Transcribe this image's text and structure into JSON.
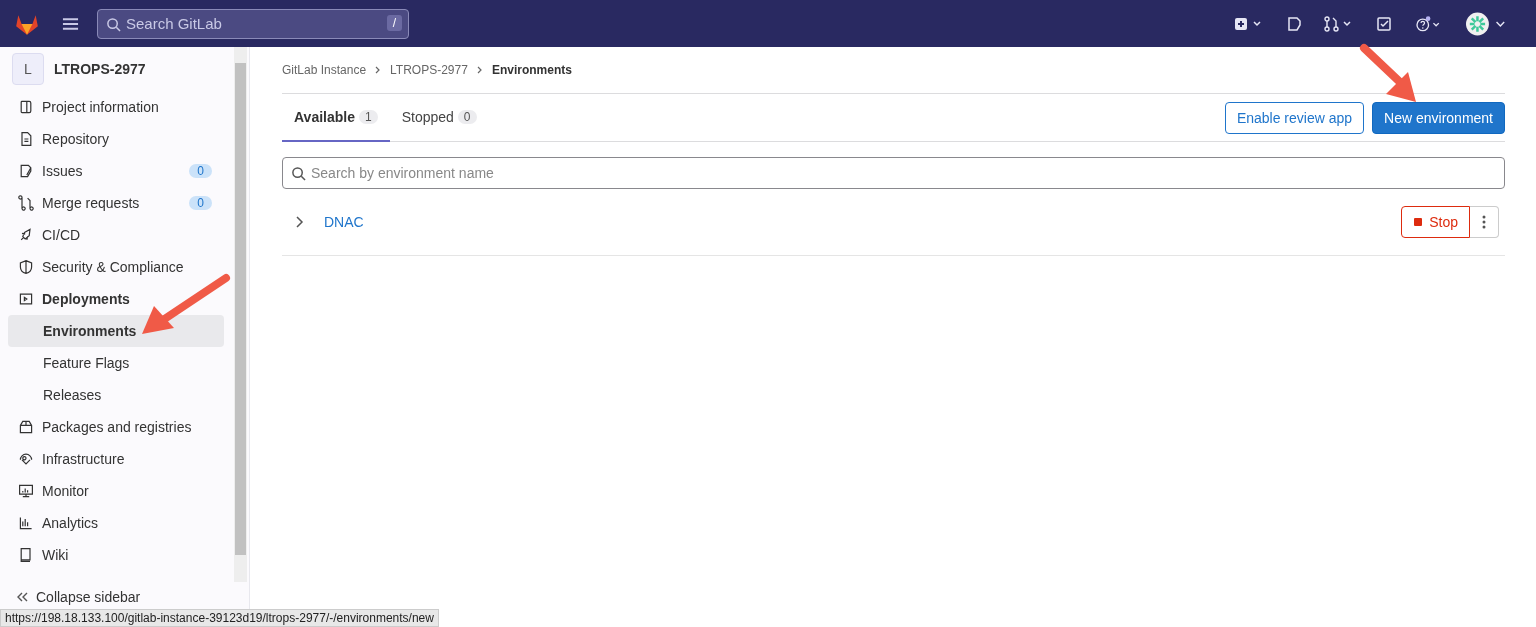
{
  "topbar": {
    "search": {
      "placeholder": "Search GitLab",
      "shortcut": "/"
    },
    "help_notification": true
  },
  "sidebar": {
    "project": {
      "avatar": "L",
      "name": "LTROPS-2977"
    },
    "items": [
      {
        "label": "Project information",
        "selected": false
      },
      {
        "label": "Repository",
        "selected": false
      },
      {
        "label": "Issues",
        "selected": false,
        "count": "0"
      },
      {
        "label": "Merge requests",
        "selected": false,
        "count": "0"
      },
      {
        "label": "CI/CD",
        "selected": false
      },
      {
        "label": "Security & Compliance",
        "selected": false
      },
      {
        "label": "Deployments",
        "selected": false,
        "expanded": true,
        "children": [
          {
            "label": "Environments",
            "selected": true
          },
          {
            "label": "Feature Flags",
            "selected": false
          },
          {
            "label": "Releases",
            "selected": false
          }
        ]
      },
      {
        "label": "Packages and registries",
        "selected": false
      },
      {
        "label": "Infrastructure",
        "selected": false
      },
      {
        "label": "Monitor",
        "selected": false
      },
      {
        "label": "Analytics",
        "selected": false
      },
      {
        "label": "Wiki",
        "selected": false
      }
    ],
    "collapse": "Collapse sidebar"
  },
  "breadcrumbs": [
    "GitLab Instance",
    "LTROPS-2977",
    "Environments"
  ],
  "tabs": [
    {
      "label": "Available",
      "count": "1",
      "selected": true
    },
    {
      "label": "Stopped",
      "count": "0",
      "selected": false
    }
  ],
  "actions": {
    "secondary": "Enable review app",
    "primary": "New environment"
  },
  "search": {
    "placeholder": "Search by environment name"
  },
  "environments": [
    {
      "name": "DNAC",
      "expanded": false,
      "stop": "Stop"
    }
  ],
  "status_url": "https://198.18.133.100/gitlab-instance-39123d19/ltrops-2977/-/environments/new"
}
